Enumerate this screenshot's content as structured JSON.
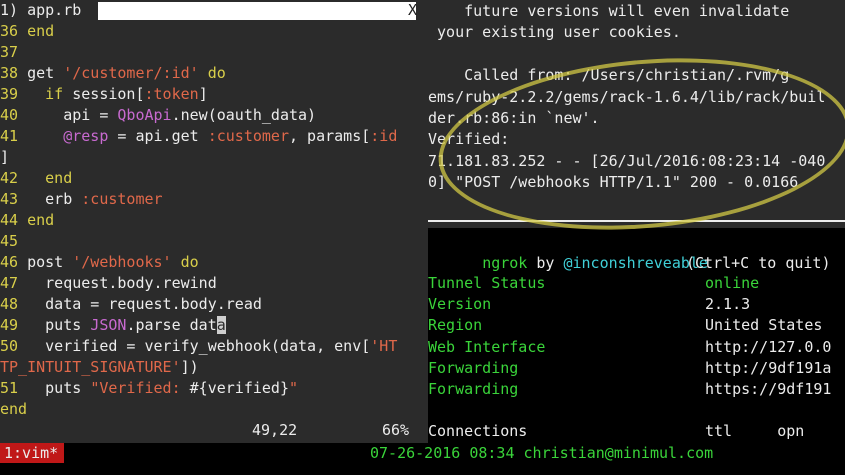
{
  "left_pane": {
    "tab_title": "1) app.rb",
    "tab_close": "X",
    "lines": [
      {
        "n": "36",
        "parts": [
          {
            "c": "kw",
            "t": "end"
          }
        ]
      },
      {
        "n": "37",
        "parts": []
      },
      {
        "n": "38",
        "parts": [
          {
            "c": "txt",
            "t": "get "
          },
          {
            "c": "str",
            "t": "'/customer/:id'"
          },
          {
            "c": "kw",
            "t": " do"
          }
        ]
      },
      {
        "n": "39",
        "parts": [
          {
            "c": "kw",
            "t": "  if "
          },
          {
            "c": "txt",
            "t": "session["
          },
          {
            "c": "sym",
            "t": ":token"
          },
          {
            "c": "txt",
            "t": "]"
          }
        ]
      },
      {
        "n": "40",
        "parts": [
          {
            "c": "txt",
            "t": "    api = "
          },
          {
            "c": "cls",
            "t": "QboApi"
          },
          {
            "c": "txt",
            "t": ".new(oauth_data)"
          }
        ]
      },
      {
        "n": "41",
        "parts": [
          {
            "c": "ivar",
            "t": "    @resp"
          },
          {
            "c": "txt",
            "t": " = api.get "
          },
          {
            "c": "sym",
            "t": ":customer"
          },
          {
            "c": "txt",
            "t": ", params["
          },
          {
            "c": "sym",
            "t": ":id"
          }
        ]
      },
      {
        "n": "",
        "parts": [
          {
            "c": "txt",
            "t": "]"
          }
        ]
      },
      {
        "n": "42",
        "parts": [
          {
            "c": "kw",
            "t": "  end"
          }
        ]
      },
      {
        "n": "43",
        "parts": [
          {
            "c": "txt",
            "t": "  erb "
          },
          {
            "c": "sym",
            "t": ":customer"
          }
        ]
      },
      {
        "n": "44",
        "parts": [
          {
            "c": "kw",
            "t": "end"
          }
        ]
      },
      {
        "n": "45",
        "parts": []
      },
      {
        "n": "46",
        "parts": [
          {
            "c": "txt",
            "t": "post "
          },
          {
            "c": "str",
            "t": "'/webhooks'"
          },
          {
            "c": "kw",
            "t": " do"
          }
        ]
      },
      {
        "n": "47",
        "parts": [
          {
            "c": "txt",
            "t": "  request.body.rewind"
          }
        ]
      },
      {
        "n": "48",
        "parts": [
          {
            "c": "txt",
            "t": "  data = request.body.read"
          }
        ]
      },
      {
        "n": "49",
        "parts": [
          {
            "c": "txt",
            "t": "  puts "
          },
          {
            "c": "cls",
            "t": "JSON"
          },
          {
            "c": "txt",
            "t": ".parse dat"
          },
          {
            "c": "cursor",
            "t": "a"
          }
        ]
      },
      {
        "n": "50",
        "parts": [
          {
            "c": "txt",
            "t": "  verified = verify_webhook(data, env["
          },
          {
            "c": "str",
            "t": "'HT"
          }
        ]
      },
      {
        "n": "",
        "parts": [
          {
            "c": "str",
            "t": "TP_INTUIT_SIGNATURE'"
          },
          {
            "c": "txt",
            "t": "])"
          }
        ]
      },
      {
        "n": "51",
        "parts": [
          {
            "c": "txt",
            "t": "  puts "
          },
          {
            "c": "str",
            "t": "\"Verified: "
          },
          {
            "c": "txt",
            "t": "#{verified}"
          },
          {
            "c": "str",
            "t": "\""
          }
        ]
      },
      {
        "n": "",
        "parts": [
          {
            "c": "kw",
            "t": "end"
          }
        ],
        "raw_ln": true
      }
    ],
    "position": "49,22",
    "percent": "66%"
  },
  "right_pane": {
    "log_lines": [
      "    future versions will even invalidate",
      " your existing user cookies.",
      "",
      "    Called from: /Users/christian/.rvm/g",
      "ems/ruby-2.2.2/gems/rack-1.6.4/lib/rack/buil",
      "der.rb:86:in `new'.",
      "Verified:",
      "71.181.83.252 - - [26/Jul/2016:08:23:14 -040",
      "0] \"POST /webhooks HTTP/1.1\" 200 - 0.0166"
    ],
    "ngrok": {
      "name": "ngrok",
      "by": " by ",
      "author": "@inconshreveable",
      "quit_hint": "(Ctrl+C to quit)",
      "rows": [
        {
          "label": "Tunnel Status",
          "value": "online"
        },
        {
          "label": "Version",
          "value": "2.1.3"
        },
        {
          "label": "Region",
          "value": "United States"
        },
        {
          "label": "Web Interface",
          "value": "http://127.0.0"
        },
        {
          "label": "Forwarding",
          "value": "http://9df191a"
        },
        {
          "label": "Forwarding",
          "value": "https://9df191"
        },
        {
          "label": "",
          "value": ""
        },
        {
          "label": "Connections",
          "value": "ttl     opn"
        }
      ]
    }
  },
  "bottom_bar": {
    "tab_label": "1:vim*",
    "status": "07-26-2016 08:34 christian@minimul.com"
  }
}
